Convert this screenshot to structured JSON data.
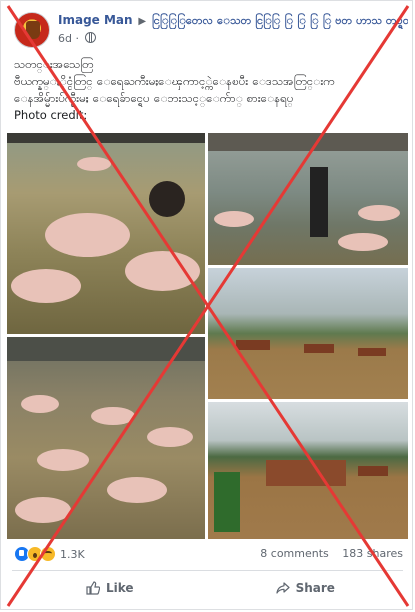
{
  "post": {
    "author": "Image Man",
    "group": "ငြြြြတေလ ေသတ ငြြြ ြ ြ ြ ြ ဗတ  ဟာသ တပ္ရတ",
    "time": "6d",
    "text_lines": [
      "သတင္းအသေတြ",
      "ဗီယက္နမ္ႏိုင္ငံတြင္ ေရေႀကီးမႈေၾကာင့္ကဲေနၿပီး ေဒသအတြင္းက",
      "ေနအိမ္မ်ားပ်က္စီးမႈ ေရေခ်ာင္ရေပ ေဘးသင့္ေက်ာ္ စားေနရပ္",
      "Photo credit;"
    ]
  },
  "photos": [
    {
      "name": "flooded-pig-farm-swimming"
    },
    {
      "name": "flooded-barn-man-standing"
    },
    {
      "name": "flooded-village-mountains"
    },
    {
      "name": "pigs-floating-in-barn"
    },
    {
      "name": "flooded-houses-banana-tree"
    }
  ],
  "stats": {
    "reaction_count": "1.3K",
    "comments": "8 comments",
    "shares": "183 shares"
  },
  "actions": {
    "like": "Like",
    "share": "Share"
  },
  "colors": {
    "link": "#385898",
    "like_blue": "#1877f2",
    "reaction_yellow": "#f7b928",
    "cross_red": "#e53935"
  }
}
